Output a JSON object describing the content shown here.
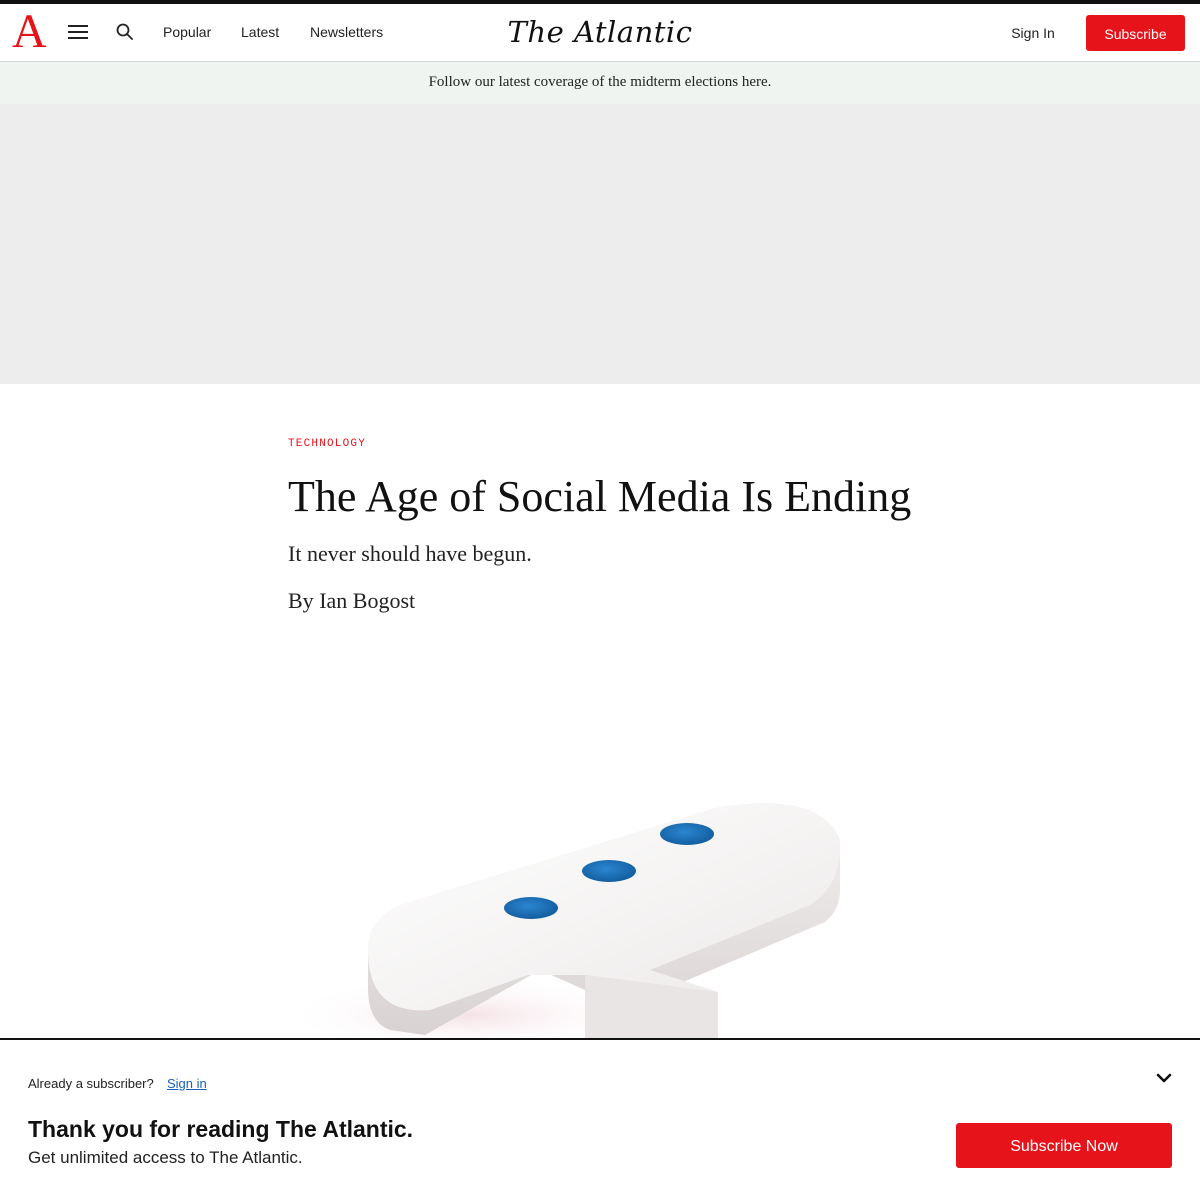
{
  "header": {
    "logo_letter": "A",
    "nav": [
      "Popular",
      "Latest",
      "Newsletters"
    ],
    "brand": "The Atlantic",
    "sign_in": "Sign In",
    "subscribe": "Subscribe",
    "icons": {
      "menu": "hamburger-icon",
      "search": "search-icon"
    }
  },
  "banner": {
    "text": "Follow our latest coverage of the midterm elections here."
  },
  "article": {
    "section": "TECHNOLOGY",
    "title": "The Age of Social Media Is Ending",
    "dek": "It never should have begun.",
    "byline_prefix": "By ",
    "author": "Ian Bogost"
  },
  "paywall": {
    "already": "Already a subscriber?",
    "sign_in": "Sign in",
    "title": "Thank you for reading The Atlantic.",
    "subtitle": "Get unlimited access to The Atlantic.",
    "button": "Subscribe Now",
    "icons": {
      "collapse": "chevron-down-icon"
    }
  },
  "colors": {
    "brand_red": "#e7131a",
    "banner_bg": "#eff4f1",
    "ad_bg": "#ededed",
    "dot_blue": "#1f6fb5"
  }
}
